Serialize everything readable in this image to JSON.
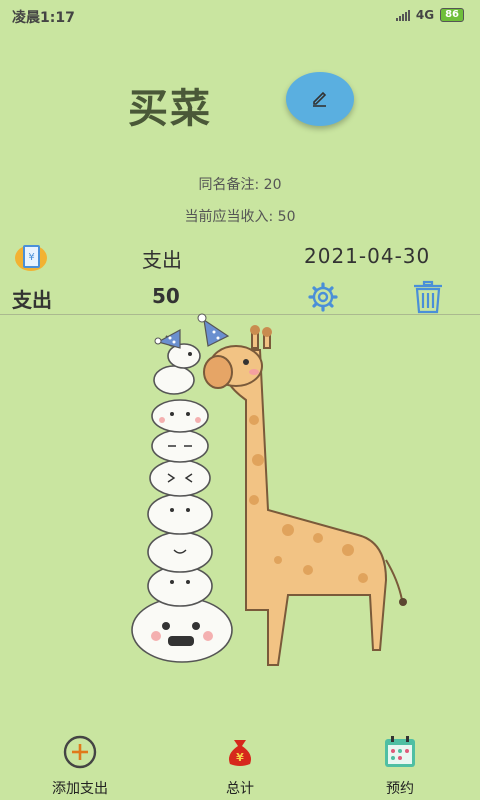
{
  "status_bar": {
    "time": "凌晨1:17",
    "network": "4G",
    "battery": "86"
  },
  "header": {
    "title": "买菜",
    "edit_icon": "pencil-icon"
  },
  "info": {
    "same_name_note": "同名备注: 20",
    "current_income": "当前应当收入: 50"
  },
  "record": {
    "icon": "money-book-icon",
    "type": "支出",
    "date": "2021-04-30",
    "amount_type": "支出",
    "amount": "50",
    "settings_icon": "gear-icon",
    "delete_icon": "trash-icon"
  },
  "bottom_nav": {
    "items": [
      {
        "label": "添加支出",
        "icon": "plus-circle-icon"
      },
      {
        "label": "总计",
        "icon": "money-bag-icon"
      },
      {
        "label": "预约",
        "icon": "calendar-icon"
      }
    ]
  }
}
